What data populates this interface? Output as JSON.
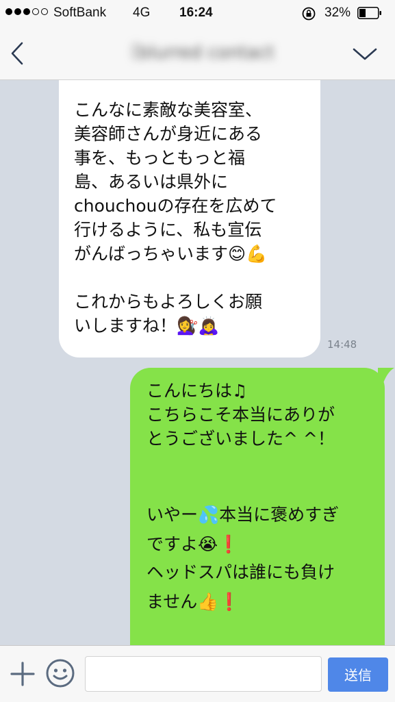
{
  "status_bar": {
    "carrier": "SoftBank",
    "network": "4G",
    "time": "16:24",
    "battery": "32%",
    "signal_bars_filled": 3,
    "signal_bars_total": 5
  },
  "header": {
    "title": "〔blurred contact name〕",
    "back_icon": "chevron-left-icon",
    "menu_icon": "chevron-down-icon"
  },
  "messages": [
    {
      "direction": "incoming",
      "time": "14:48",
      "lines": [
        "こんなに素敵な美容室、",
        "美容師さんが身近にある",
        "事を、もっともっと福",
        "島、あるいは県外に",
        "chouchouの存在を広めて",
        "行けるように、私も宣伝",
        "がんばっちゃいます😊💪",
        "",
        "これからもよろしくお願",
        "いしますね！💇‍♀️🙇‍♀️"
      ]
    },
    {
      "direction": "outgoing",
      "lines": [
        "こんにちは♫",
        "こちらこそ本当にありが",
        "とうございました^ ^！",
        "",
        "",
        "いやー💦本当に褒めすぎ",
        "ですよ😭❗",
        "ヘッドスパは誰にも負け",
        "ません👍❗"
      ]
    }
  ],
  "input_bar": {
    "placeholder": "",
    "send_label": "送信",
    "plus_icon": "plus-icon",
    "sticker_icon": "smiley-icon"
  },
  "colors": {
    "chat_background": "#d4dae3",
    "incoming_bubble": "#ffffff",
    "outgoing_bubble": "#85e249",
    "send_button": "#4f87e8",
    "header_background": "#f7f7f7"
  }
}
